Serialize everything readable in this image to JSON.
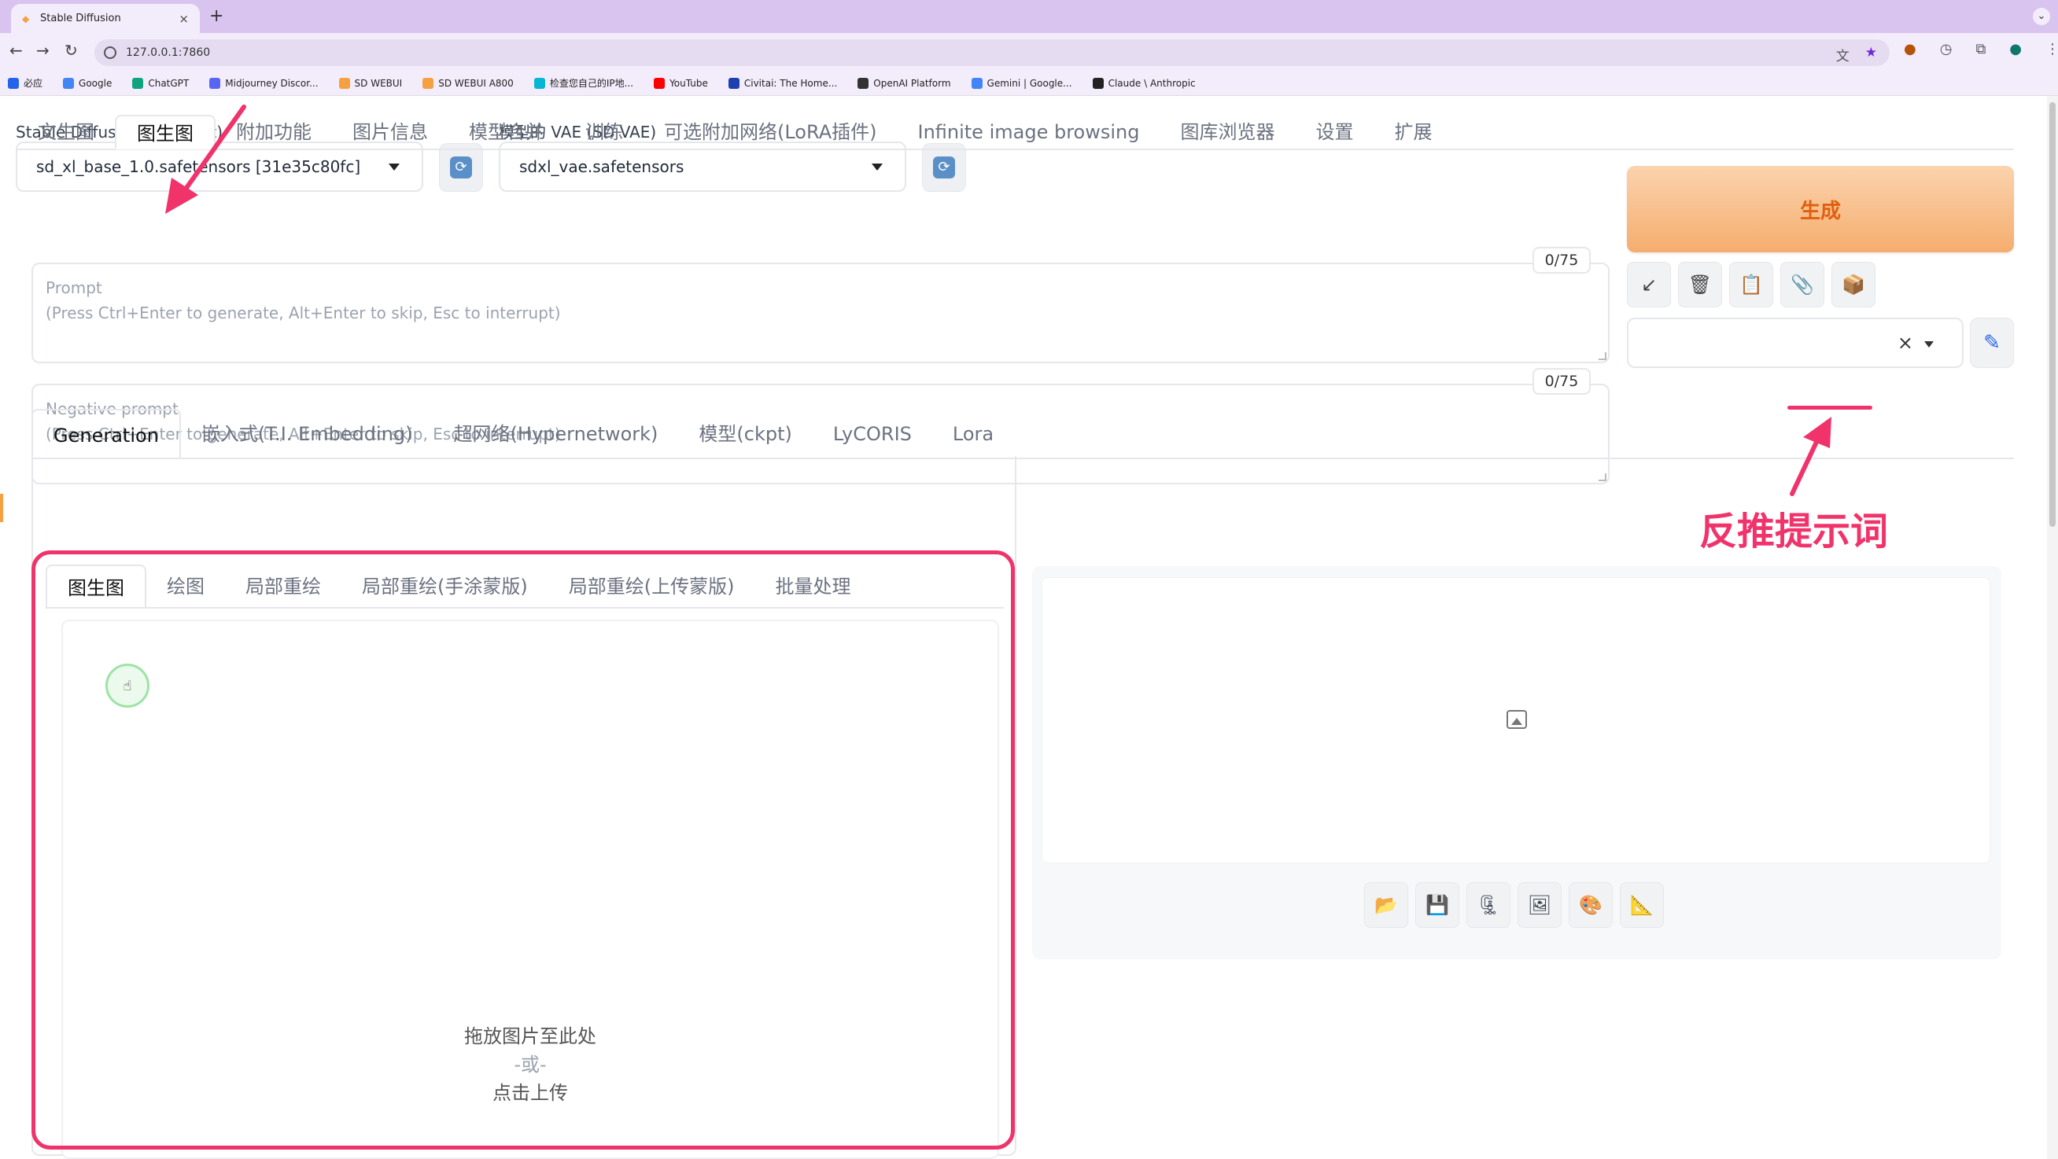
{
  "browser": {
    "tab_title": "Stable Diffusion",
    "tab_close": "×",
    "new_tab": "+",
    "tab_menu": "⌄",
    "url": "127.0.0.1:7860",
    "bookmarks": [
      {
        "label": "必应",
        "icon": "search-icon",
        "color": "#2563eb"
      },
      {
        "label": "Google",
        "icon": "google-icon",
        "color": "#4285f4"
      },
      {
        "label": "ChatGPT",
        "icon": "chatgpt-icon",
        "color": "#10a37f"
      },
      {
        "label": "Midjourney Discor...",
        "icon": "discord-icon",
        "color": "#5865f2"
      },
      {
        "label": "SD WEBUI",
        "icon": "sd-icon",
        "color": "#f5a142"
      },
      {
        "label": "SD WEBUI A800",
        "icon": "sd-icon",
        "color": "#f5a142"
      },
      {
        "label": "检查您自己的IP地...",
        "icon": "ip-icon",
        "color": "#06b6d4"
      },
      {
        "label": "YouTube",
        "icon": "youtube-icon",
        "color": "#ff0000"
      },
      {
        "label": "Civitai: The Home...",
        "icon": "civitai-icon",
        "color": "#1e40af"
      },
      {
        "label": "OpenAI Platform",
        "icon": "openai-icon",
        "color": "#333333"
      },
      {
        "label": "Gemini | Google...",
        "icon": "google-icon",
        "color": "#4285f4"
      },
      {
        "label": "Claude \\ Anthropic",
        "icon": "anthropic-icon",
        "color": "#222222"
      }
    ]
  },
  "header": {
    "checkpoint_label": "Stable Diffusion 模型(ckpt)",
    "checkpoint_value": "sd_xl_base_1.0.safetensors [31e35c80fc]",
    "vae_label": "模型的 VAE (SD VAE)",
    "vae_value": "sdxl_vae.safetensors"
  },
  "main_tabs": [
    "文生图",
    "图生图",
    "附加功能",
    "图片信息",
    "模型合并",
    "训练",
    "可选附加网络(LoRA插件)",
    "Infinite image browsing",
    "图库浏览器",
    "设置",
    "扩展"
  ],
  "prompt": {
    "label": "Prompt",
    "hint": "(Press Ctrl+Enter to generate, Alt+Enter to skip, Esc to interrupt)",
    "token_count": "0/75"
  },
  "negative_prompt": {
    "label": "Negative prompt",
    "hint": "(Press Ctrl+Enter to generate, Alt+Enter to skip, Esc to interrupt)",
    "token_count": "0/75"
  },
  "generate": {
    "label": "生成",
    "color": "#e0600f"
  },
  "tool_buttons": [
    {
      "icon": "arrow-down-left-icon",
      "glyph": "↙"
    },
    {
      "icon": "trash-icon",
      "glyph": "🗑"
    },
    {
      "icon": "clipboard-icon",
      "glyph": "📋"
    },
    {
      "icon": "paperclip-icon",
      "glyph": "📎"
    },
    {
      "icon": "package-icon",
      "glyph": "📦"
    }
  ],
  "styles": {
    "clear": "×",
    "edit_icon": "pencil-icon",
    "edit_glyph": "✎"
  },
  "sub_tabs": [
    "Generation",
    "嵌入式(T.I. Embedding)",
    "超网络(Hypernetwork)",
    "模型(ckpt)",
    "LyCORIS",
    "Lora"
  ],
  "image_tabs": [
    "图生图",
    "绘图",
    "局部重绘",
    "局部重绘(手涂蒙版)",
    "局部重绘(上传蒙版)",
    "批量处理"
  ],
  "upload": {
    "line1": "拖放图片至此处",
    "line2": "-或-",
    "line3": "点击上传"
  },
  "output_buttons": [
    {
      "icon": "folder-icon",
      "glyph": "📂"
    },
    {
      "icon": "save-icon",
      "glyph": "💾"
    },
    {
      "icon": "zip-icon",
      "glyph": "🗜"
    },
    {
      "icon": "image-icon",
      "glyph": "🖼"
    },
    {
      "icon": "palette-icon",
      "glyph": "🎨"
    },
    {
      "icon": "ruler-icon",
      "glyph": "📐"
    }
  ],
  "annotation": {
    "label": "反推提示词",
    "color": "#f0336b"
  }
}
